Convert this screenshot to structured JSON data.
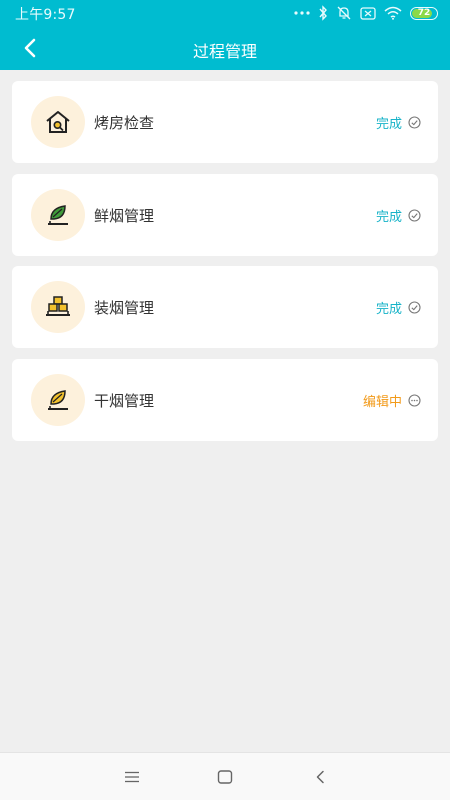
{
  "status_bar": {
    "time": "上午9:57",
    "battery": "72",
    "icons": [
      "more-dots-icon",
      "bluetooth-icon",
      "notifications-off-icon",
      "sim-icon",
      "wifi-icon",
      "battery-icon"
    ]
  },
  "toolbar": {
    "title": "过程管理",
    "back_icon": "chevron-left-icon"
  },
  "items": [
    {
      "label": "烤房检查",
      "status": "完成",
      "state": "done",
      "icon": "house-icon"
    },
    {
      "label": "鲜烟管理",
      "status": "完成",
      "state": "done",
      "icon": "leaf-icon"
    },
    {
      "label": "装烟管理",
      "status": "完成",
      "state": "done",
      "icon": "boxes-icon"
    },
    {
      "label": "干烟管理",
      "status": "编辑中",
      "state": "editing",
      "icon": "leaf-icon"
    }
  ],
  "colors": {
    "header": "#00bcd0",
    "done": "#17b3c8",
    "editing": "#f29a1a",
    "icon_bg": "#fdf1dc",
    "icon_green": "#3f9b3a",
    "icon_yellow": "#f2c12e"
  },
  "bottom_nav": [
    "menu-icon",
    "home-square-icon",
    "back-chevron-icon"
  ]
}
